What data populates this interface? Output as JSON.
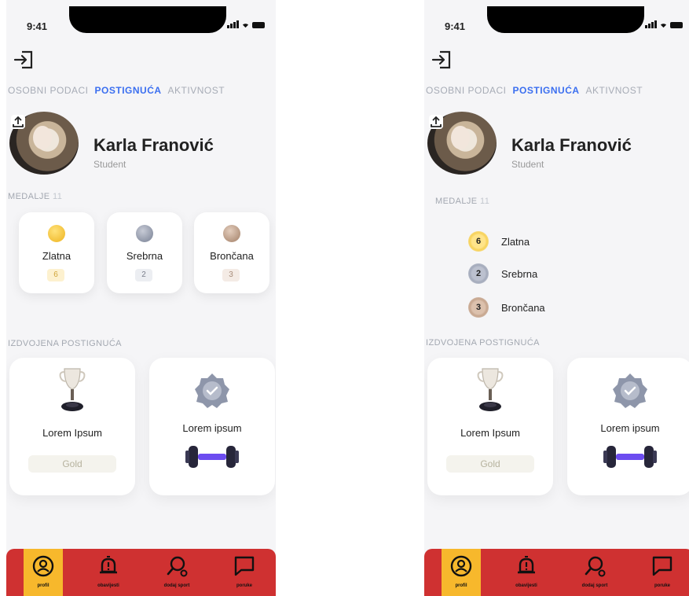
{
  "screens": [
    {
      "status": {
        "time": "9:41"
      },
      "tabs": [
        "OSOBNI PODACI",
        "POSTIGNUĆA",
        "AKTIVNOST"
      ],
      "profile": {
        "name": "Karla Franović",
        "role": "Student"
      },
      "medals": {
        "label": "MEDALJE",
        "count": "11",
        "items": [
          {
            "name": "Zlatna",
            "count": "6",
            "color": "#f3c13a"
          },
          {
            "name": "Srebrna",
            "count": "2",
            "color": "#9aa0b0"
          },
          {
            "name": "Brončana",
            "count": "3",
            "color": "#c2a58f"
          }
        ]
      },
      "featured": {
        "label": "IZDVOJENA POSTIGNUĆA",
        "items": [
          {
            "title": "Lorem Ipsum",
            "badge": "Gold",
            "icon": "trophy-icon"
          },
          {
            "title": "Lorem ipsum",
            "icon": "dumbbell-icon",
            "badge_icon": "check-badge-icon"
          }
        ]
      },
      "nav": [
        {
          "label": "profil",
          "icon": "user-circle-icon"
        },
        {
          "label": "obavijesti",
          "icon": "bell-icon"
        },
        {
          "label": "dodaj sport",
          "icon": "search-plus-icon"
        },
        {
          "label": "poruke",
          "icon": "message-icon"
        }
      ],
      "colors": {
        "accent": "#3b6ff0",
        "nav_bg": "#cf3131",
        "nav_active": "#f7b82c"
      }
    },
    {
      "status": {
        "time": "9:41"
      },
      "tabs": [
        "OSOBNI PODACI",
        "POSTIGNUĆA",
        "AKTIVNOST"
      ],
      "profile": {
        "name": "Karla Franović",
        "role": "Student"
      },
      "medals": {
        "label": "MEDALJE",
        "count": "11",
        "items": [
          {
            "name": "Zlatna",
            "count": "6",
            "color": "#f3c13a"
          },
          {
            "name": "Srebrna",
            "count": "2",
            "color": "#9aa0b0"
          },
          {
            "name": "Brončana",
            "count": "3",
            "color": "#c2a58f"
          }
        ]
      },
      "featured": {
        "label": "IZDVOJENA POSTIGNUĆA",
        "items": [
          {
            "title": "Lorem Ipsum",
            "badge": "Gold",
            "icon": "trophy-icon"
          },
          {
            "title": "Lorem ipsum",
            "icon": "dumbbell-icon",
            "badge_icon": "check-badge-icon"
          }
        ]
      },
      "nav": [
        {
          "label": "profil",
          "icon": "user-circle-icon"
        },
        {
          "label": "obavijesti",
          "icon": "bell-icon"
        },
        {
          "label": "dodaj sport",
          "icon": "search-plus-icon"
        },
        {
          "label": "poruke",
          "icon": "message-icon"
        }
      ],
      "colors": {
        "accent": "#3b6ff0",
        "nav_bg": "#cf3131",
        "nav_active": "#f7b82c"
      }
    }
  ]
}
